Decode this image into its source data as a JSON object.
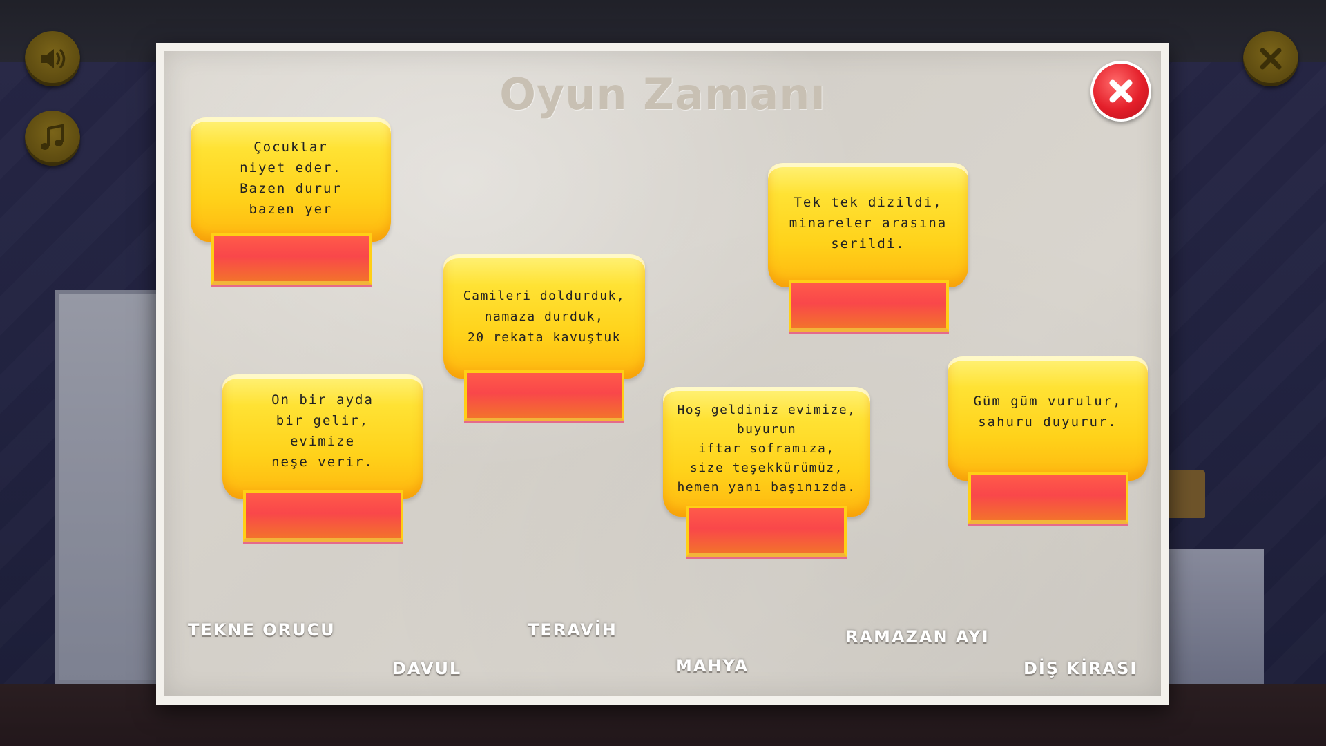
{
  "game": {
    "title": "Oyun Zamanı"
  },
  "controls": {
    "sound_icon": "speaker-icon",
    "music_icon": "music-note-icon",
    "exit_icon": "close-icon"
  },
  "cards": [
    {
      "text": "Çocuklar\nniyet eder.\nBazen durur\nbazen yer"
    },
    {
      "text": "Camileri doldurduk,\nnamaza durduk,\n20 rekata kavuştuk"
    },
    {
      "text": "Tek tek dizildi,\nminareler arasına\nserildi."
    },
    {
      "text": "On bir ayda\nbir gelir,\nevimize\nneşe verir."
    },
    {
      "text": "Hoş geldiniz evimize,\nbuyurun\niftar soframıza,\nsize teşekkürümüz,\nhemen yanı başınızda."
    },
    {
      "text": "Güm güm vurulur,\nsahuru duyurur."
    }
  ],
  "answers": [
    "TEKNE ORUCU",
    "DAVUL",
    "TERAVİH",
    "MAHYA",
    "RAMAZAN AYI",
    "DİŞ KİRASI"
  ],
  "colors": {
    "card_yellow": "#ffd21a",
    "slot_red": "#f9474a",
    "close_red": "#e41f2a",
    "paper": "#d8d4cd"
  }
}
